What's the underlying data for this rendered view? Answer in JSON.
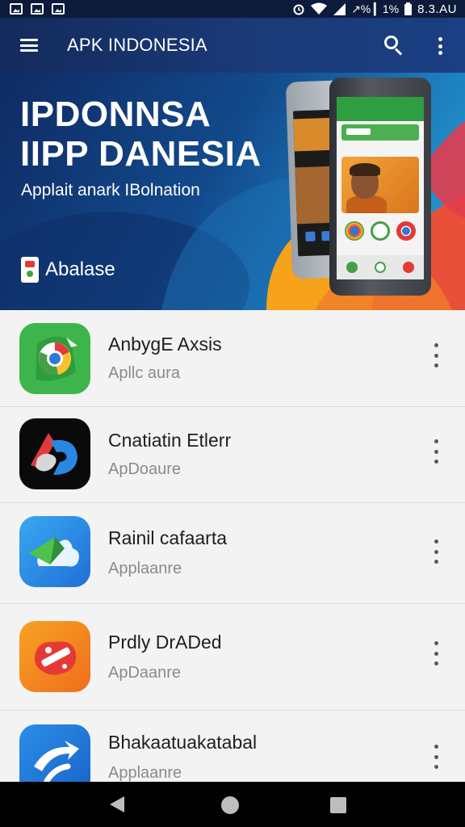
{
  "status_bar": {
    "right_text": "↗% ▎1%",
    "time": "8.3.AU",
    "left_icons": [
      "image-icon",
      "image-icon",
      "image-icon"
    ],
    "right_icons": [
      "alarm-icon",
      "wifi-icon",
      "signal-icon",
      "battery-icon"
    ]
  },
  "app_bar": {
    "title": "APK INDONESIA",
    "menu_icon": "hamburger-icon",
    "search_icon": "search-icon",
    "overflow_icon": "more-vert-icon"
  },
  "banner": {
    "title_line1": "IPDONNSA",
    "title_line2": "IIPP DANESIA",
    "subtitle": "Applait anark IBolnation",
    "badge_label": "Abalase"
  },
  "apps": [
    {
      "name": "AnbygE Axsis",
      "category": "Apllc aura",
      "icon": "chrome-green-icon"
    },
    {
      "name": "Cnatiatin Etlerr",
      "category": "ApDoaure",
      "icon": "black-red-blue-icon"
    },
    {
      "name": "Rainil cafaarta",
      "category": "Applaanre",
      "icon": "blue-cloud-icon"
    },
    {
      "name": "Prdly DrADed",
      "category": "ApDaanre",
      "icon": "orange-game-icon"
    },
    {
      "name": "Bhakaatuakatabal",
      "category": "Applaanre",
      "icon": "blue-arrow-icon"
    }
  ],
  "nav_bar": {
    "back_icon": "back-icon",
    "home_icon": "home-icon",
    "recents_icon": "recents-icon"
  },
  "colors": {
    "app_bar": "#1a3a78",
    "list_background": "#f3f3f3",
    "nav_bar": "#000000"
  }
}
